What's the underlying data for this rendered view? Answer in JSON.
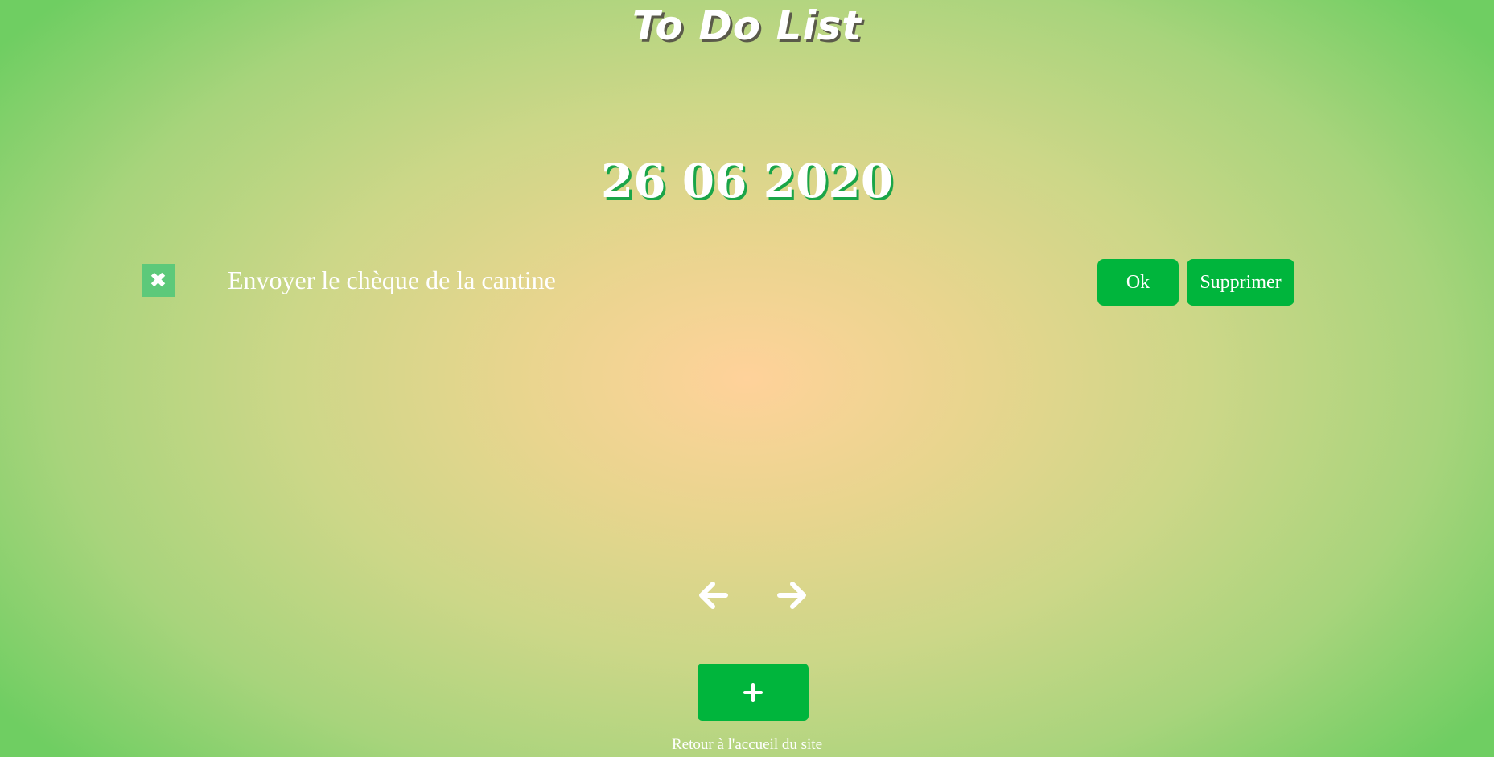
{
  "header": {
    "title": "To Do List"
  },
  "date": {
    "label": "26 06 2020"
  },
  "tasks": [
    {
      "check_icon": "close-x-icon",
      "text": "Envoyer le chèque de la cantine",
      "ok_label": "Ok",
      "delete_label": "Supprimer"
    }
  ],
  "navigation": {
    "previous_icon": "arrow-left-icon",
    "next_icon": "arrow-right-icon"
  },
  "add_button": {
    "icon": "plus-icon"
  },
  "footer": {
    "link_text": "Retour à l'accueil du site"
  },
  "colors": {
    "accent": "#00b53c",
    "check_box": "#5dc97a",
    "background_center": "#ffd29a",
    "background_edge": "#6fce62",
    "text": "#ffffff"
  }
}
